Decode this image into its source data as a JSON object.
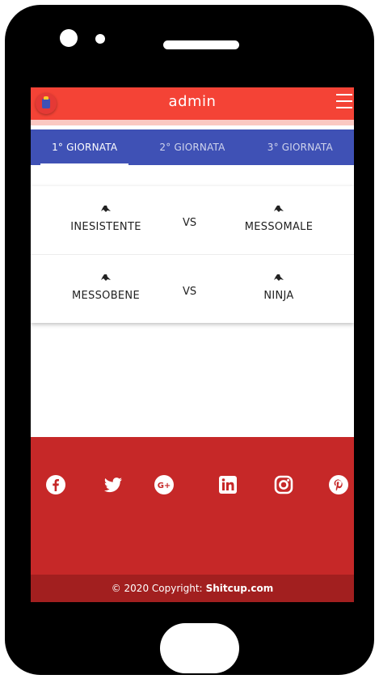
{
  "header": {
    "title": "admin",
    "logo_icon": "pencil-mascot-icon",
    "menu_icon": "hamburger-icon"
  },
  "tabs": [
    {
      "label": "1° GIORNATA",
      "active": true
    },
    {
      "label": "2° GIORNATA",
      "active": false
    },
    {
      "label": "3° GIORNATA",
      "active": false
    }
  ],
  "matches": [
    {
      "home": "INESISTENTE",
      "vs": "VS",
      "away": "MESSOMALE"
    },
    {
      "home": "MESSOBENE",
      "vs": "VS",
      "away": "NINJA"
    }
  ],
  "footer": {
    "socials": [
      "facebook-icon",
      "twitter-icon",
      "google-plus-icon",
      "linkedin-icon",
      "instagram-icon",
      "pinterest-icon"
    ],
    "copyright_prefix": "© 2020 Copyright:",
    "copyright_site": "Shitcup.com"
  },
  "colors": {
    "header": "#f44336",
    "tabs": "#3f51b5",
    "footer": "#c62828",
    "copyright_bar": "#a21f1f"
  }
}
